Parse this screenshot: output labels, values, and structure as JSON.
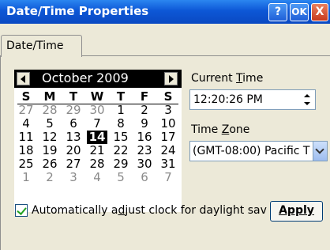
{
  "window": {
    "title": "Date/Time Properties",
    "help_label": "?",
    "ok_label": "OK",
    "close_label": "X"
  },
  "tabs": [
    {
      "label": "Date/Time",
      "active": true
    }
  ],
  "calendar": {
    "month_label": "October 2009",
    "weekdays": [
      "S",
      "M",
      "T",
      "W",
      "T",
      "F",
      "S"
    ],
    "weeks": [
      [
        {
          "d": "27",
          "other": true
        },
        {
          "d": "28",
          "other": true
        },
        {
          "d": "29",
          "other": true
        },
        {
          "d": "30",
          "other": true
        },
        {
          "d": "1"
        },
        {
          "d": "2"
        },
        {
          "d": "3"
        }
      ],
      [
        {
          "d": "4"
        },
        {
          "d": "5"
        },
        {
          "d": "6"
        },
        {
          "d": "7"
        },
        {
          "d": "8"
        },
        {
          "d": "9"
        },
        {
          "d": "10"
        }
      ],
      [
        {
          "d": "11"
        },
        {
          "d": "12"
        },
        {
          "d": "13"
        },
        {
          "d": "14",
          "selected": true
        },
        {
          "d": "15"
        },
        {
          "d": "16"
        },
        {
          "d": "17"
        }
      ],
      [
        {
          "d": "18"
        },
        {
          "d": "19"
        },
        {
          "d": "20"
        },
        {
          "d": "21"
        },
        {
          "d": "22"
        },
        {
          "d": "23"
        },
        {
          "d": "24"
        }
      ],
      [
        {
          "d": "25"
        },
        {
          "d": "26"
        },
        {
          "d": "27"
        },
        {
          "d": "28"
        },
        {
          "d": "29"
        },
        {
          "d": "30"
        },
        {
          "d": "31"
        }
      ],
      [
        {
          "d": "1",
          "other": true
        },
        {
          "d": "2",
          "other": true
        },
        {
          "d": "3",
          "other": true
        },
        {
          "d": "4",
          "other": true
        },
        {
          "d": "5",
          "other": true
        },
        {
          "d": "6",
          "other": true
        },
        {
          "d": "7",
          "other": true
        }
      ]
    ]
  },
  "time": {
    "label": "Current Time",
    "label_key": "T",
    "value": "12:20:26 PM"
  },
  "timezone": {
    "label": "Time Zone",
    "label_key": "Z",
    "value": "(GMT-08:00) Pacific T"
  },
  "dst": {
    "label": "Automatically adjust clock for daylight sav",
    "label_key": "d",
    "checked": true
  },
  "apply_label": "Apply",
  "colors": {
    "titlebar": "#0d57d6",
    "dialog_bg": "#ece9d8",
    "selected_day_bg": "#000000"
  }
}
